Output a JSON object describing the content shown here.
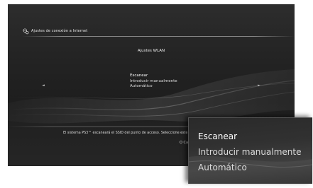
{
  "header": {
    "title": "Ajustes de conexión a Internet",
    "icon": "globe-settings-icon"
  },
  "screen": {
    "title": "Ajustes WLAN",
    "options": [
      {
        "label": "Escanear",
        "selected": true
      },
      {
        "label": "Introducir manualmente",
        "selected": false
      },
      {
        "label": "Automático",
        "selected": false
      }
    ],
    "nav": {
      "left": "◄",
      "right": "►"
    },
    "status_text": "El sistema PS3™ escaneará el SSID del punto de acceso. Seleccione este",
    "button_hint": "O Ca"
  },
  "zoom": {
    "options": [
      {
        "label": "Escanear",
        "selected": true
      },
      {
        "label": "Introducir manualmente",
        "selected": false
      },
      {
        "label": "Automático",
        "selected": false
      }
    ]
  },
  "colors": {
    "background": "#1f1f1f",
    "text": "#e6e6e6",
    "wave": "#8a8a8a"
  }
}
